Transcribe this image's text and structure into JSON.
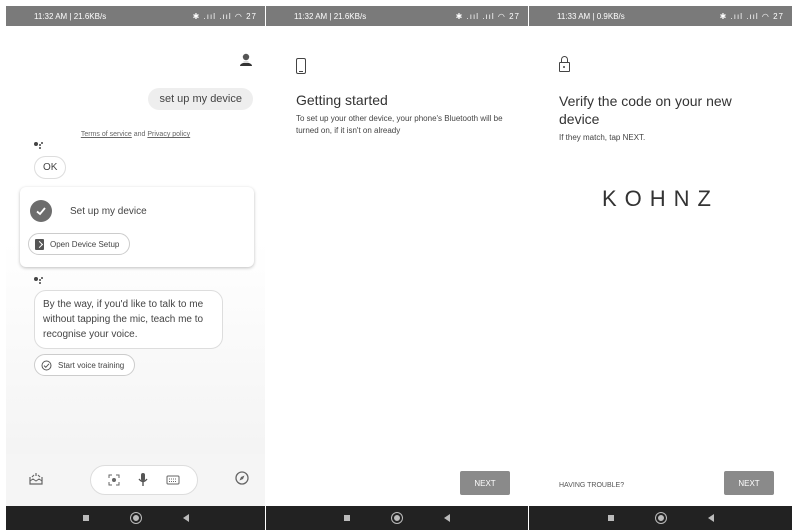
{
  "screen1": {
    "status": {
      "left": "11:32 AM | 21.6KB/s",
      "right": "✱ .ııl .ııl ◠ 27"
    },
    "user_message": "set up my device",
    "terms": {
      "terms_link": "Terms of service",
      "and": " and ",
      "privacy_link": "Privacy policy"
    },
    "ok_reply": "OK",
    "card": {
      "title": "Set up my device",
      "action": "Open Device Setup"
    },
    "voice_tip": "By the way, if you'd like to talk to me without tapping the mic, teach me to recognise your voice.",
    "voice_chip": "Start voice training"
  },
  "screen2": {
    "status": {
      "left": "11:32 AM | 21.6KB/s",
      "right": "✱ .ııl .ııl ◠ 27"
    },
    "heading": "Getting started",
    "body": "To set up your other device, your phone's Bluetooth will be turned on, if it isn't on already",
    "next": "NEXT"
  },
  "screen3": {
    "status": {
      "left": "11:33 AM | 0.9KB/s",
      "right": "✱ .ııl .ııl ◠ 27"
    },
    "heading": "Verify the code on your new device",
    "body": "If they match, tap NEXT.",
    "code": "KOHNZ",
    "trouble": "HAVING TROUBLE?",
    "next": "NEXT"
  }
}
